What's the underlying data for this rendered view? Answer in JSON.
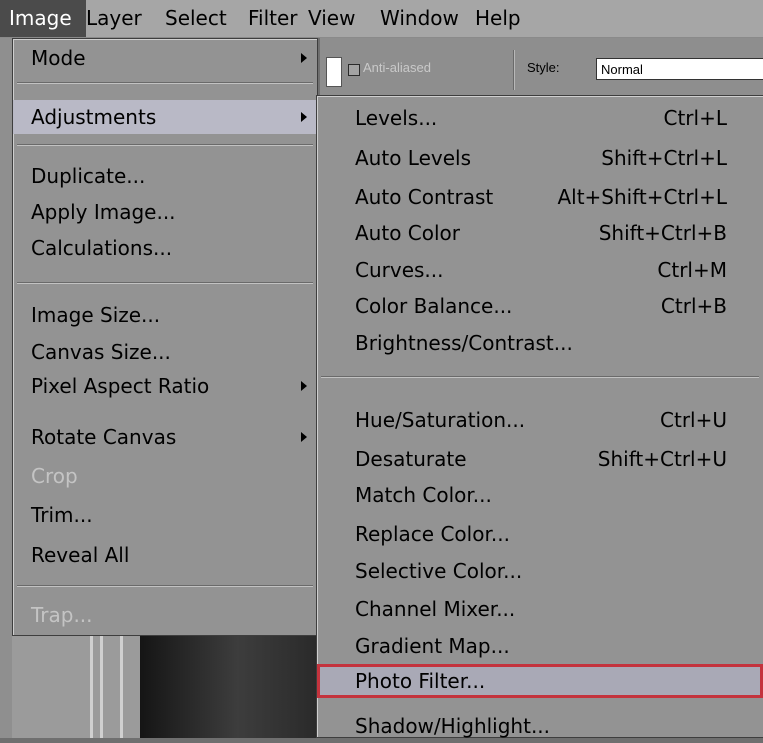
{
  "menubar": {
    "items": [
      "Image",
      "Layer",
      "Select",
      "Filter",
      "View",
      "Window",
      "Help"
    ]
  },
  "options_bar": {
    "anti_aliased_label": "Anti-aliased",
    "anti_aliased_checked": false,
    "style_label": "Style:",
    "style_value": "Normal"
  },
  "image_menu": {
    "items": [
      {
        "label": "Mode",
        "submenu": true
      },
      {
        "label": "Adjustments",
        "submenu": true,
        "highlighted": true
      },
      {
        "label": "Duplicate..."
      },
      {
        "label": "Apply Image..."
      },
      {
        "label": "Calculations..."
      },
      {
        "label": "Image Size..."
      },
      {
        "label": "Canvas Size..."
      },
      {
        "label": "Pixel Aspect Ratio",
        "submenu": true
      },
      {
        "label": "Rotate Canvas",
        "submenu": true
      },
      {
        "label": "Crop",
        "disabled": true
      },
      {
        "label": "Trim..."
      },
      {
        "label": "Reveal All"
      },
      {
        "label": "Trap...",
        "disabled": true
      }
    ]
  },
  "adjustments_menu": {
    "items": [
      {
        "label": "Levels...",
        "shortcut": "Ctrl+L"
      },
      {
        "label": "Auto Levels",
        "shortcut": "Shift+Ctrl+L"
      },
      {
        "label": "Auto Contrast",
        "shortcut": "Alt+Shift+Ctrl+L"
      },
      {
        "label": "Auto Color",
        "shortcut": "Shift+Ctrl+B"
      },
      {
        "label": "Curves...",
        "shortcut": "Ctrl+M"
      },
      {
        "label": "Color Balance...",
        "shortcut": "Ctrl+B"
      },
      {
        "label": "Brightness/Contrast...",
        "shortcut": ""
      },
      {
        "label": "Hue/Saturation...",
        "shortcut": "Ctrl+U"
      },
      {
        "label": "Desaturate",
        "shortcut": "Shift+Ctrl+U"
      },
      {
        "label": "Match Color...",
        "shortcut": ""
      },
      {
        "label": "Replace Color...",
        "shortcut": ""
      },
      {
        "label": "Selective Color...",
        "shortcut": ""
      },
      {
        "label": "Channel Mixer...",
        "shortcut": ""
      },
      {
        "label": "Gradient Map...",
        "shortcut": ""
      },
      {
        "label": "Photo Filter...",
        "shortcut": "",
        "selected": true
      },
      {
        "label": "Shadow/Highlight...",
        "shortcut": ""
      }
    ]
  },
  "colors": {
    "menu_bg": "#939393",
    "highlight": "#b9b9c6",
    "selection_border": "#c4333d",
    "active_menubar": "#4b4b4b"
  }
}
